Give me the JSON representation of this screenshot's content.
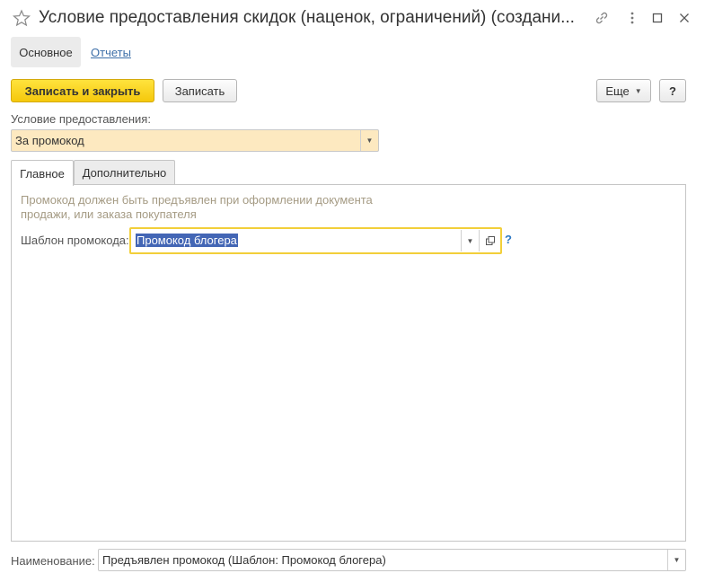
{
  "window": {
    "title": "Условие предоставления скидок (наценок, ограничений) (создани..."
  },
  "nav": {
    "main_label": "Основное",
    "reports_label": "Отчеты"
  },
  "toolbar": {
    "save_close_label": "Записать и закрыть",
    "save_label": "Записать",
    "more_label": "Еще",
    "help_label": "?"
  },
  "condition": {
    "label": "Условие предоставления:",
    "value": "За промокод"
  },
  "tabs": [
    {
      "label": "Главное",
      "active": true
    },
    {
      "label": "Дополнительно",
      "active": false
    }
  ],
  "main_tab": {
    "hint_line1": "Промокод должен быть предъявлен при оформлении документа",
    "hint_line2": "продажи, или заказа покупателя",
    "promo_label": "Шаблон промокода:",
    "promo_value": "Промокод блогера",
    "promo_help": "?"
  },
  "name_field": {
    "label": "Наименование:",
    "value": "Предъявлен промокод (Шаблон: Промокод блогера)"
  },
  "colors": {
    "accent_yellow": "#f5c80c",
    "condition_bg": "#fde9c0",
    "link_blue": "#3d6fa8",
    "selection_blue": "#4366b5"
  }
}
